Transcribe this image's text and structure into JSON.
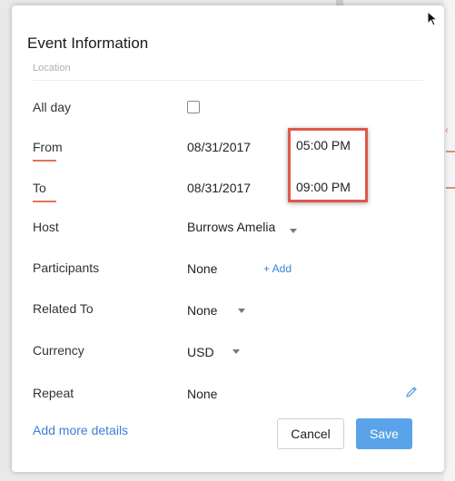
{
  "dialog": {
    "title": "Event Information",
    "location_placeholder": "Location"
  },
  "fields": {
    "all_day": {
      "label": "All day",
      "checked": false
    },
    "from": {
      "label": "From",
      "date": "08/31/2017",
      "time": "05:00 PM"
    },
    "to": {
      "label": "To",
      "date": "08/31/2017",
      "time": "09:00 PM"
    },
    "host": {
      "label": "Host",
      "value": "Burrows Amelia"
    },
    "participants": {
      "label": "Participants",
      "value": "None",
      "add_label": "+ Add"
    },
    "related_to": {
      "label": "Related To",
      "value": "None"
    },
    "currency": {
      "label": "Currency",
      "value": "USD"
    },
    "repeat": {
      "label": "Repeat",
      "value": "None"
    }
  },
  "footer": {
    "add_more_details": "Add more details",
    "cancel_label": "Cancel",
    "save_label": "Save"
  },
  "colors": {
    "accent_blue": "#3d7fd6",
    "save_button": "#5ba3e8",
    "highlight_red": "#dc5a4b",
    "required_underline": "#e8735c"
  },
  "icons": {
    "edit": "pencil-icon",
    "dropdown": "caret-down-icon",
    "cursor": "mouse-pointer-icon"
  }
}
